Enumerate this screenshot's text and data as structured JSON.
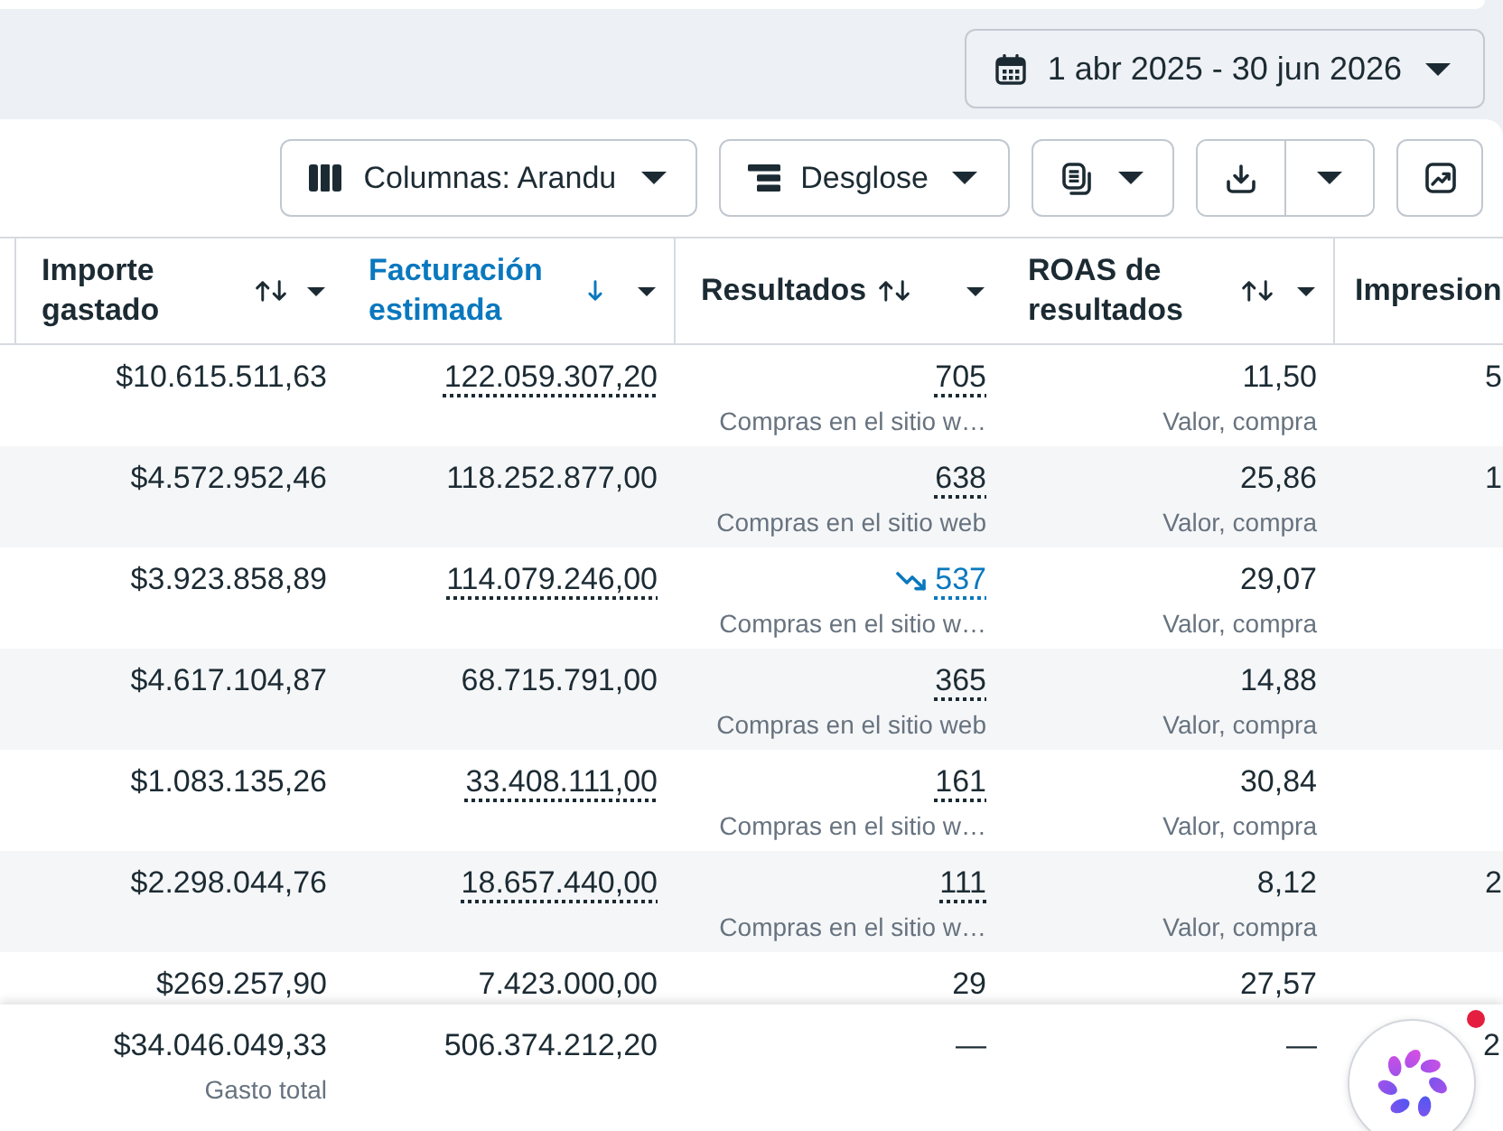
{
  "date_range": {
    "label": "1 abr 2025 - 30 jun 2026"
  },
  "toolbar": {
    "buttons": [
      {
        "kind": "columns",
        "label": "Columnas: Arandu"
      },
      {
        "kind": "breakdown",
        "label": "Desglose"
      },
      {
        "kind": "reports"
      },
      {
        "kind": "export"
      },
      {
        "kind": "charts"
      }
    ]
  },
  "table": {
    "columns": [
      {
        "label": "Importe gastado",
        "sorted": false
      },
      {
        "label": "Facturación estimada",
        "sorted": true
      },
      {
        "label": "Resultados",
        "sorted": false
      },
      {
        "label": "ROAS de resultados",
        "sorted": false
      },
      {
        "label": "Impresion"
      }
    ],
    "rows": [
      {
        "cells": [
          {
            "value": "$10.615.511,63",
            "underlined": false
          },
          {
            "value": "122.059.307,20",
            "underlined": true
          },
          {
            "value": "705",
            "underlined": true,
            "trend_down": false,
            "label": "Compras en el sitio w…"
          },
          {
            "value": "11,50",
            "underlined": false,
            "label": "Valor, compra"
          }
        ],
        "column_5": "5"
      },
      {
        "cells": [
          {
            "value": "$4.572.952,46",
            "underlined": false
          },
          {
            "value": "118.252.877,00",
            "underlined": false
          },
          {
            "value": "638",
            "underlined": true,
            "trend_down": false,
            "label": "Compras en el sitio web"
          },
          {
            "value": "25,86",
            "underlined": false,
            "label": "Valor, compra"
          }
        ],
        "column_5": "1"
      },
      {
        "cells": [
          {
            "value": "$3.923.858,89",
            "underlined": false
          },
          {
            "value": "114.079.246,00",
            "underlined": true
          },
          {
            "value": "537",
            "underlined": true,
            "trend_down": true,
            "label": "Compras en el sitio w…"
          },
          {
            "value": "29,07",
            "underlined": false,
            "label": "Valor, compra"
          }
        ]
      },
      {
        "cells": [
          {
            "value": "$4.617.104,87",
            "underlined": false
          },
          {
            "value": "68.715.791,00",
            "underlined": false
          },
          {
            "value": "365",
            "underlined": true,
            "trend_down": false,
            "label": "Compras en el sitio web"
          },
          {
            "value": "14,88",
            "underlined": false,
            "label": "Valor, compra"
          }
        ]
      },
      {
        "cells": [
          {
            "value": "$1.083.135,26",
            "underlined": false
          },
          {
            "value": "33.408.111,00",
            "underlined": true
          },
          {
            "value": "161",
            "underlined": true,
            "trend_down": false,
            "label": "Compras en el sitio w…"
          },
          {
            "value": "30,84",
            "underlined": false,
            "label": "Valor, compra"
          }
        ]
      },
      {
        "cells": [
          {
            "value": "$2.298.044,76",
            "underlined": false
          },
          {
            "value": "18.657.440,00",
            "underlined": true
          },
          {
            "value": "111",
            "underlined": true,
            "trend_down": false,
            "label": "Compras en el sitio w…"
          },
          {
            "value": "8,12",
            "underlined": false,
            "label": "Valor, compra"
          }
        ],
        "column_5": "2"
      },
      {
        "cells": [
          {
            "value": "$269.257,90"
          },
          {
            "value": "7.423.000,00"
          },
          {
            "value": "29"
          },
          {
            "value": "27,57"
          }
        ]
      }
    ],
    "totals": {
      "cells": [
        {
          "value": "$34.046.049,33",
          "label": "Gasto total"
        },
        {
          "value": "506.374.212,20"
        },
        {
          "value": "—"
        },
        {
          "value": "—"
        }
      ],
      "column_5": "2"
    }
  },
  "assistant_button": {
    "notification": true
  }
}
